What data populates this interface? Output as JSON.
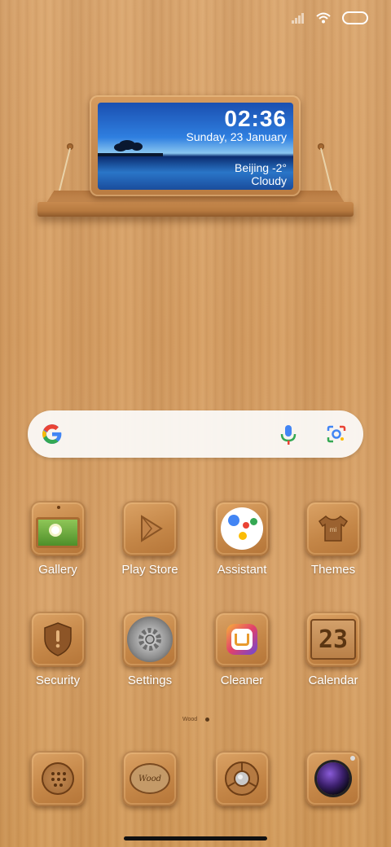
{
  "status_bar": {
    "signal": "signal-icon",
    "wifi": "wifi-icon",
    "battery": "battery-icon"
  },
  "widget": {
    "time": "02:36",
    "date": "Sunday, 23 January",
    "city_temp": "Beijing -2°",
    "condition": "Cloudy"
  },
  "search": {
    "google_icon": "google-icon",
    "mic_icon": "mic-icon",
    "lens_icon": "lens-icon"
  },
  "apps_row1": [
    {
      "label": "Gallery",
      "icon": "gallery-icon"
    },
    {
      "label": "Play Store",
      "icon": "play-store-icon"
    },
    {
      "label": "Assistant",
      "icon": "assistant-icon"
    },
    {
      "label": "Themes",
      "icon": "themes-icon"
    }
  ],
  "apps_row2": [
    {
      "label": "Security",
      "icon": "security-icon"
    },
    {
      "label": "Settings",
      "icon": "settings-icon"
    },
    {
      "label": "Cleaner",
      "icon": "cleaner-icon"
    },
    {
      "label": "Calendar",
      "icon": "calendar-icon",
      "day": "23"
    }
  ],
  "page_indicator": {
    "label": "Wood"
  },
  "dock": [
    {
      "icon": "phone-icon"
    },
    {
      "icon": "messages-icon",
      "text": "Wood"
    },
    {
      "icon": "chrome-icon"
    },
    {
      "icon": "camera-icon"
    }
  ],
  "colors": {
    "accent_blue": "#4285F4",
    "accent_red": "#EA4335",
    "accent_yellow": "#FBBC05",
    "accent_green": "#34A853"
  }
}
